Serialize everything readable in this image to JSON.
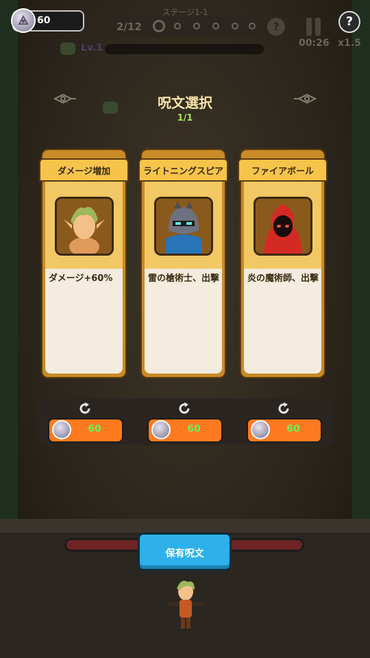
{
  "hud": {
    "gems": "60",
    "stage": "ステージ1-1",
    "wave": "2/12",
    "level": "Lv.1",
    "timer": "00:26",
    "speed": "x1.5",
    "help_label": "?",
    "help_small": "?"
  },
  "modal": {
    "title": "呪文選択",
    "pick_count": "1/1"
  },
  "cards": [
    {
      "title": "ダメージ増加",
      "desc": "ダメージ+60%",
      "price": "60",
      "portrait": "elf-archer-portrait"
    },
    {
      "title": "ライトニングスピア",
      "desc": "雷の槍術士、出撃",
      "price": "60",
      "portrait": "armored-knight-portrait"
    },
    {
      "title": "ファイアボール",
      "desc": "炎の魔術師、出撃",
      "price": "60",
      "portrait": "fire-mage-portrait"
    }
  ],
  "bottom": {
    "owned_spells_label": "保有呪文"
  },
  "colors": {
    "card_gold": "#f6c44a",
    "price_green": "#6ff05a",
    "reroll_orange": "#ff7a1f",
    "button_blue": "#2eb1ea",
    "title_cream": "#fbe6a8",
    "count_green": "#a6e05a"
  }
}
